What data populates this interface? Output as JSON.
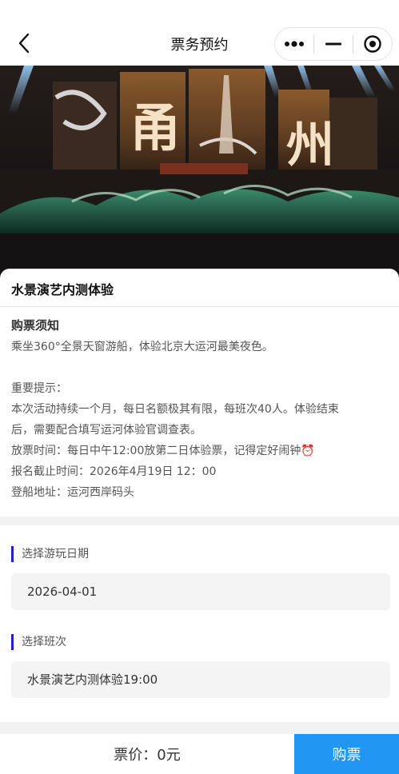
{
  "nav": {
    "title": "票务预约",
    "back_icon": "chevron-left-icon",
    "menu_icons": [
      "more-dots-icon",
      "minimize-icon",
      "target-close-icon"
    ]
  },
  "banner": {
    "alt_glyphs": [
      "甬",
      "州"
    ]
  },
  "event": {
    "title": "水景演艺内测体验"
  },
  "notice": {
    "heading": "购票须知",
    "line1": "乘坐360°全景天窗游船，体验北京大运河最美夜色。",
    "line2": "重要提示：",
    "line3": "本次活动持续一个月，每日名额极其有限，每班次40人。体验结束",
    "line4": "后，需要配合填写运河体验官调查表。",
    "line5": "放票时间：每日中午12:00放第二日体验票，记得定好闹钟",
    "alarm_emoji": "⏰",
    "line6": "报名截止时间：2026年4月19日 12：00",
    "line7": "登船地址：运河西岸码头"
  },
  "form": {
    "date_label": "选择游玩日期",
    "date_value": "2026-04-01",
    "session_label": "选择班次",
    "session_value": "水景演艺内测体验19:00"
  },
  "footer": {
    "price_text": "票价：0元",
    "buy_label": "购票"
  },
  "colors": {
    "accent_blue": "#2196f3",
    "label_bar": "#2222cc"
  }
}
